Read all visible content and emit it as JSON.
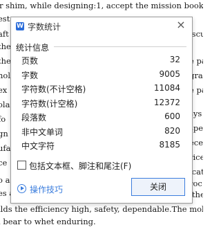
{
  "document": {
    "line1": "r shim, while designing:1, accept the mission book.2",
    "line12": "ilds the efficiency high, safety, dependable.The mold",
    "line13": "l bear to whet enduring.",
    "right_fragments": [
      "iscu",
      "e pa",
      "gra",
      "e pa",
      "sys",
      "spe",
      "ece",
      "rice",
      "icat",
      "roc",
      "f the"
    ],
    "left_fragments": [
      "ests",
      "aft",
      "the",
      "the",
      "nolc",
      "ex",
      "olac",
      "fo",
      "gn",
      "ufa",
      "ce",
      "o a",
      "es a"
    ]
  },
  "dialog": {
    "app_icon_letter": "W",
    "title": "字数统计",
    "close_symbol": "×",
    "section_title": "统计信息",
    "stats": [
      {
        "label": "页数",
        "value": "32"
      },
      {
        "label": "字数",
        "value": "9005"
      },
      {
        "label": "字符数(不计空格)",
        "value": "11084"
      },
      {
        "label": "字符数(计空格)",
        "value": "12372"
      },
      {
        "label": "段落数",
        "value": "600"
      },
      {
        "label": "非中文单词",
        "value": "820"
      },
      {
        "label": "中文字符",
        "value": "8185"
      }
    ],
    "checkbox_label": "包括文本框、脚注和尾注(F)",
    "checkbox_checked": false,
    "tips_label": "操作技巧",
    "close_button": "关闭"
  },
  "colors": {
    "accent": "#3b7ddd",
    "app_icon": "#2b6cd9"
  }
}
